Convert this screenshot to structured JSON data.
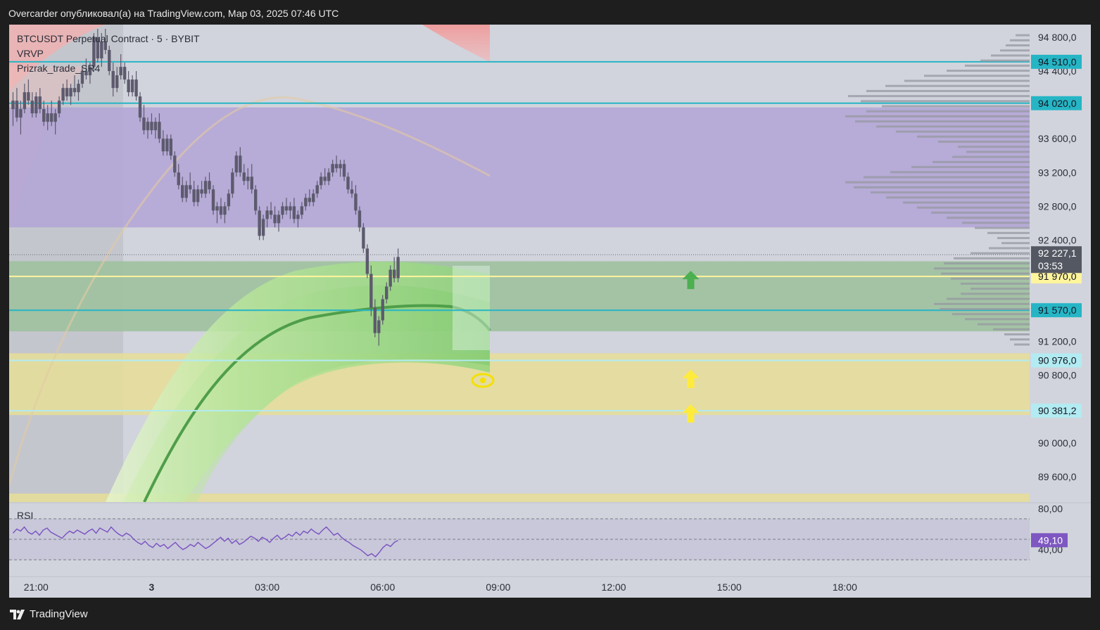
{
  "header": {
    "caption": "Overcarder опубликовал(а) на TradingView.com, Мар 03, 2025 07:46 UTC"
  },
  "footer": {
    "brand": "TradingView"
  },
  "legend": {
    "symbol": "BTCUSDT Perpetual Contract · 5 · BYBIT",
    "indicator_1": "VRVP",
    "indicator_2": "Prizrak_trade_SR4"
  },
  "colors": {
    "frame_bg": "#1e1e1e",
    "chart_bg": "#d1d4dc",
    "purple_zone": "#b4a6d6",
    "green_zone": "#9fc19f",
    "yellow_zone": "#e6dd9a",
    "cyan_line": "#26b5c5",
    "light_cyan_line": "#b2ebf2",
    "yellow_line": "#fff59d",
    "candle": "#5d5a6e",
    "rsi_line": "#7e57c2",
    "rsi_badge": "#7e57c2",
    "price_badge": "#545863"
  },
  "chart_data": {
    "type": "candlestick",
    "title": "",
    "symbol": "BTCUSDT Perpetual Contract · 5 · BYBIT",
    "interval": "5",
    "exchange": "BYBIT",
    "price_axis": {
      "range": [
        89300,
        94950
      ],
      "ticks": [
        "94 800,0",
        "94 400,0",
        "93 600,0",
        "93 200,0",
        "92 800,0",
        "92 400,0",
        "91 200,0",
        "90 800,0",
        "90 000,0",
        "89 600,0"
      ],
      "tick_values": [
        94800,
        94400,
        93600,
        93200,
        92800,
        92400,
        91200,
        90800,
        90000,
        89600
      ]
    },
    "time_axis": {
      "labels": [
        "21:00",
        "3",
        "03:00",
        "06:00",
        "09:00",
        "12:00",
        "15:00",
        "18:00"
      ],
      "label_hours": [
        -3,
        0,
        3,
        6,
        9,
        12,
        15,
        18
      ],
      "range_hours": [
        -3.7,
        22.8
      ]
    },
    "current_price": {
      "value": 92227.1,
      "label": "92 227,1",
      "countdown": "03:53"
    },
    "levels": [
      {
        "price": 94510,
        "label": "94 510,0",
        "style": "cyan"
      },
      {
        "price": 94020,
        "label": "94 020,0",
        "style": "cyan"
      },
      {
        "price": 91970,
        "label": "91 970,0",
        "style": "yellow"
      },
      {
        "price": 91570,
        "label": "91 570,0",
        "style": "cyan"
      },
      {
        "price": 90976,
        "label": "90 976,0",
        "style": "lightcyan"
      },
      {
        "price": 90381.2,
        "label": "90 381,2",
        "style": "lightcyan"
      }
    ],
    "zones": [
      {
        "name": "resistance-zone",
        "from": 92550,
        "to": 93970,
        "color": "#b4a6d6"
      },
      {
        "name": "support-zone-green",
        "from": 91320,
        "to": 92150,
        "color": "#9fc19f"
      },
      {
        "name": "support-zone-yellow",
        "from": 90330,
        "to": 91060,
        "color": "#e6dd9a"
      },
      {
        "name": "support-zone-yellow-low",
        "from": 89300,
        "to": 89400,
        "color": "#e6dd9a"
      }
    ],
    "arrows": [
      {
        "hour": 14.0,
        "price": 91920,
        "color": "#4caf50"
      },
      {
        "hour": 14.0,
        "price": 90750,
        "color": "#ffeb3b"
      },
      {
        "hour": 14.0,
        "price": 90340,
        "color": "#ffeb3b"
      }
    ],
    "candles": [
      [
        -3.6,
        93950,
        94150,
        93750,
        94050
      ],
      [
        -3.5,
        94050,
        94200,
        93800,
        93850
      ],
      [
        -3.4,
        93850,
        94050,
        93650,
        93950
      ],
      [
        -3.3,
        93950,
        94250,
        93900,
        94150
      ],
      [
        -3.2,
        94150,
        94300,
        94000,
        94050
      ],
      [
        -3.1,
        94050,
        94150,
        93850,
        93900
      ],
      [
        -3.0,
        93900,
        94150,
        93850,
        94100
      ],
      [
        -2.9,
        94100,
        94200,
        93900,
        93950
      ],
      [
        -2.8,
        93950,
        94050,
        93750,
        93800
      ],
      [
        -2.7,
        93800,
        94000,
        93700,
        93900
      ],
      [
        -2.6,
        93900,
        94050,
        93750,
        93800
      ],
      [
        -2.5,
        93800,
        93950,
        93650,
        93900
      ],
      [
        -2.4,
        93900,
        94100,
        93850,
        94050
      ],
      [
        -2.3,
        94050,
        94250,
        94000,
        94200
      ],
      [
        -2.2,
        94200,
        94300,
        94050,
        94100
      ],
      [
        -2.1,
        94100,
        94250,
        94000,
        94200
      ],
      [
        -2.0,
        94200,
        94350,
        94100,
        94150
      ],
      [
        -1.9,
        94150,
        94300,
        94050,
        94250
      ],
      [
        -1.8,
        94250,
        94450,
        94200,
        94400
      ],
      [
        -1.7,
        94400,
        94550,
        94300,
        94350
      ],
      [
        -1.6,
        94350,
        94500,
        94250,
        94450
      ],
      [
        -1.5,
        94450,
        94850,
        94400,
        94800
      ],
      [
        -1.4,
        94800,
        94900,
        94500,
        94550
      ],
      [
        -1.3,
        94550,
        94850,
        94450,
        94750
      ],
      [
        -1.2,
        94750,
        94900,
        94600,
        94650
      ],
      [
        -1.1,
        94650,
        94700,
        94350,
        94400
      ],
      [
        -1.0,
        94400,
        94500,
        94100,
        94200
      ],
      [
        -0.9,
        94200,
        94450,
        94150,
        94350
      ],
      [
        -0.8,
        94350,
        94600,
        94300,
        94450
      ],
      [
        -0.7,
        94450,
        94500,
        94250,
        94300
      ],
      [
        -0.6,
        94300,
        94400,
        94100,
        94150
      ],
      [
        -0.5,
        94150,
        94350,
        94100,
        94300
      ],
      [
        -0.4,
        94300,
        94400,
        94050,
        94100
      ],
      [
        -0.3,
        94100,
        94150,
        93800,
        93850
      ],
      [
        -0.2,
        93850,
        94000,
        93650,
        93700
      ],
      [
        -0.1,
        93700,
        93850,
        93600,
        93800
      ],
      [
        0.0,
        93800,
        93900,
        93650,
        93700
      ],
      [
        0.1,
        93700,
        93850,
        93600,
        93800
      ],
      [
        0.2,
        93800,
        93900,
        93550,
        93600
      ],
      [
        0.3,
        93600,
        93700,
        93400,
        93450
      ],
      [
        0.4,
        93450,
        93650,
        93400,
        93600
      ],
      [
        0.5,
        93600,
        93650,
        93350,
        93400
      ],
      [
        0.6,
        93400,
        93450,
        93150,
        93200
      ],
      [
        0.7,
        93200,
        93300,
        93000,
        93050
      ],
      [
        0.8,
        93050,
        93150,
        92850,
        92900
      ],
      [
        0.9,
        92900,
        93100,
        92850,
        93050
      ],
      [
        1.0,
        93050,
        93200,
        92950,
        93000
      ],
      [
        1.1,
        93000,
        93100,
        92800,
        92850
      ],
      [
        1.2,
        92850,
        93050,
        92800,
        93000
      ],
      [
        1.3,
        93000,
        93100,
        92900,
        92950
      ],
      [
        1.4,
        92950,
        93150,
        92900,
        93100
      ],
      [
        1.5,
        93100,
        93200,
        92950,
        93000
      ],
      [
        1.6,
        93000,
        93050,
        92700,
        92750
      ],
      [
        1.7,
        92750,
        92850,
        92600,
        92800
      ],
      [
        1.8,
        92800,
        92900,
        92650,
        92700
      ],
      [
        1.9,
        92700,
        92850,
        92600,
        92800
      ],
      [
        2.0,
        92800,
        93000,
        92750,
        92950
      ],
      [
        2.1,
        92950,
        93250,
        92900,
        93200
      ],
      [
        2.2,
        93200,
        93450,
        93150,
        93400
      ],
      [
        2.3,
        93400,
        93500,
        93150,
        93200
      ],
      [
        2.4,
        93200,
        93300,
        93050,
        93100
      ],
      [
        2.5,
        93100,
        93250,
        93000,
        93150
      ],
      [
        2.6,
        93150,
        93300,
        92950,
        93000
      ],
      [
        2.7,
        93000,
        93050,
        92700,
        92750
      ],
      [
        2.8,
        92750,
        92800,
        92400,
        92450
      ],
      [
        2.9,
        92450,
        92700,
        92400,
        92650
      ],
      [
        3.0,
        92650,
        92800,
        92550,
        92750
      ],
      [
        3.1,
        92750,
        92850,
        92650,
        92700
      ],
      [
        3.2,
        92700,
        92800,
        92550,
        92600
      ],
      [
        3.3,
        92600,
        92750,
        92500,
        92700
      ],
      [
        3.4,
        92700,
        92850,
        92650,
        92800
      ],
      [
        3.5,
        92800,
        92900,
        92700,
        92750
      ],
      [
        3.6,
        92750,
        92850,
        92650,
        92800
      ],
      [
        3.7,
        92800,
        92900,
        92600,
        92650
      ],
      [
        3.8,
        92650,
        92750,
        92550,
        92700
      ],
      [
        3.9,
        92700,
        92850,
        92650,
        92800
      ],
      [
        4.0,
        92800,
        92950,
        92750,
        92900
      ],
      [
        4.1,
        92900,
        93000,
        92800,
        92850
      ],
      [
        4.2,
        92850,
        93000,
        92800,
        92950
      ],
      [
        4.3,
        92950,
        93100,
        92900,
        93050
      ],
      [
        4.4,
        93050,
        93200,
        93000,
        93150
      ],
      [
        4.5,
        93150,
        93250,
        93050,
        93100
      ],
      [
        4.6,
        93100,
        93250,
        93050,
        93200
      ],
      [
        4.7,
        93200,
        93350,
        93150,
        93300
      ],
      [
        4.8,
        93300,
        93400,
        93200,
        93250
      ],
      [
        4.9,
        93250,
        93350,
        93150,
        93300
      ],
      [
        5.0,
        93300,
        93350,
        93100,
        93150
      ],
      [
        5.1,
        93150,
        93200,
        92950,
        93000
      ],
      [
        5.2,
        93000,
        93100,
        92900,
        92950
      ],
      [
        5.3,
        92950,
        93050,
        92700,
        92750
      ],
      [
        5.4,
        92750,
        92800,
        92500,
        92550
      ],
      [
        5.5,
        92550,
        92600,
        92250,
        92300
      ],
      [
        5.6,
        92300,
        92350,
        91950,
        92000
      ],
      [
        5.7,
        92000,
        92100,
        91500,
        91600
      ],
      [
        5.8,
        91600,
        91700,
        91250,
        91300
      ],
      [
        5.9,
        91300,
        91500,
        91150,
        91450
      ],
      [
        6.0,
        91450,
        91750,
        91400,
        91700
      ],
      [
        6.1,
        91700,
        91900,
        91650,
        91850
      ],
      [
        6.2,
        91850,
        92100,
        91800,
        92050
      ],
      [
        6.3,
        92050,
        92200,
        91900,
        91950
      ],
      [
        6.4,
        91950,
        92300,
        91900,
        92200
      ]
    ],
    "volume_profile": {
      "label": "VRVP",
      "rows": [
        [
          94820,
          20
        ],
        [
          94760,
          28
        ],
        [
          94700,
          34
        ],
        [
          94640,
          42
        ],
        [
          94580,
          55
        ],
        [
          94520,
          70
        ],
        [
          94460,
          92
        ],
        [
          94400,
          118
        ],
        [
          94340,
          150
        ],
        [
          94280,
          178
        ],
        [
          94220,
          205
        ],
        [
          94160,
          232
        ],
        [
          94100,
          258
        ],
        [
          94040,
          240
        ],
        [
          93980,
          210
        ],
        [
          93920,
          232
        ],
        [
          93860,
          262
        ],
        [
          93800,
          248
        ],
        [
          93740,
          218
        ],
        [
          93680,
          190
        ],
        [
          93620,
          160
        ],
        [
          93560,
          130
        ],
        [
          93500,
          102
        ],
        [
          93440,
          90
        ],
        [
          93380,
          110
        ],
        [
          93320,
          138
        ],
        [
          93260,
          168
        ],
        [
          93200,
          198
        ],
        [
          93140,
          236
        ],
        [
          93080,
          262
        ],
        [
          93020,
          250
        ],
        [
          92960,
          226
        ],
        [
          92900,
          204
        ],
        [
          92840,
          180
        ],
        [
          92780,
          160
        ],
        [
          92720,
          140
        ],
        [
          92660,
          118
        ],
        [
          92600,
          96
        ],
        [
          92540,
          78
        ],
        [
          92480,
          60
        ],
        [
          92420,
          46
        ],
        [
          92360,
          40
        ],
        [
          92300,
          58
        ],
        [
          92240,
          84
        ],
        [
          92180,
          108
        ],
        [
          92120,
          122
        ],
        [
          92060,
          136
        ],
        [
          92000,
          126
        ],
        [
          91940,
          112
        ],
        [
          91880,
          98
        ],
        [
          91820,
          84
        ],
        [
          91760,
          98
        ],
        [
          91700,
          118
        ],
        [
          91640,
          136
        ],
        [
          91580,
          128
        ],
        [
          91520,
          110
        ],
        [
          91460,
          92
        ],
        [
          91400,
          74
        ],
        [
          91340,
          52
        ],
        [
          91280,
          36
        ],
        [
          91220,
          28
        ],
        [
          91160,
          22
        ]
      ]
    },
    "rsi": {
      "label": "RSI",
      "period_lines": [
        70,
        50,
        30
      ],
      "axis_labels": [
        "80,00",
        "40,00"
      ],
      "axis_values": [
        80,
        40
      ],
      "range": [
        15,
        85
      ],
      "current": 49.1,
      "current_label": "49,10",
      "values": [
        56,
        60,
        58,
        62,
        57,
        55,
        58,
        54,
        59,
        61,
        57,
        55,
        53,
        51,
        55,
        58,
        56,
        59,
        57,
        55,
        58,
        60,
        56,
        61,
        59,
        57,
        62,
        58,
        55,
        53,
        56,
        54,
        50,
        47,
        45,
        48,
        44,
        42,
        46,
        43,
        45,
        41,
        44,
        47,
        43,
        40,
        42,
        45,
        43,
        47,
        44,
        41,
        43,
        46,
        49,
        52,
        48,
        51,
        46,
        49,
        45,
        47,
        50,
        53,
        51,
        48,
        52,
        50,
        47,
        51,
        54,
        50,
        52,
        55,
        53,
        57,
        54,
        58,
        56,
        60,
        57,
        55,
        59,
        62,
        58,
        54,
        56,
        52,
        49,
        47,
        44,
        42,
        40,
        37,
        34,
        36,
        33,
        37,
        42,
        45,
        43,
        47,
        49
      ]
    }
  }
}
